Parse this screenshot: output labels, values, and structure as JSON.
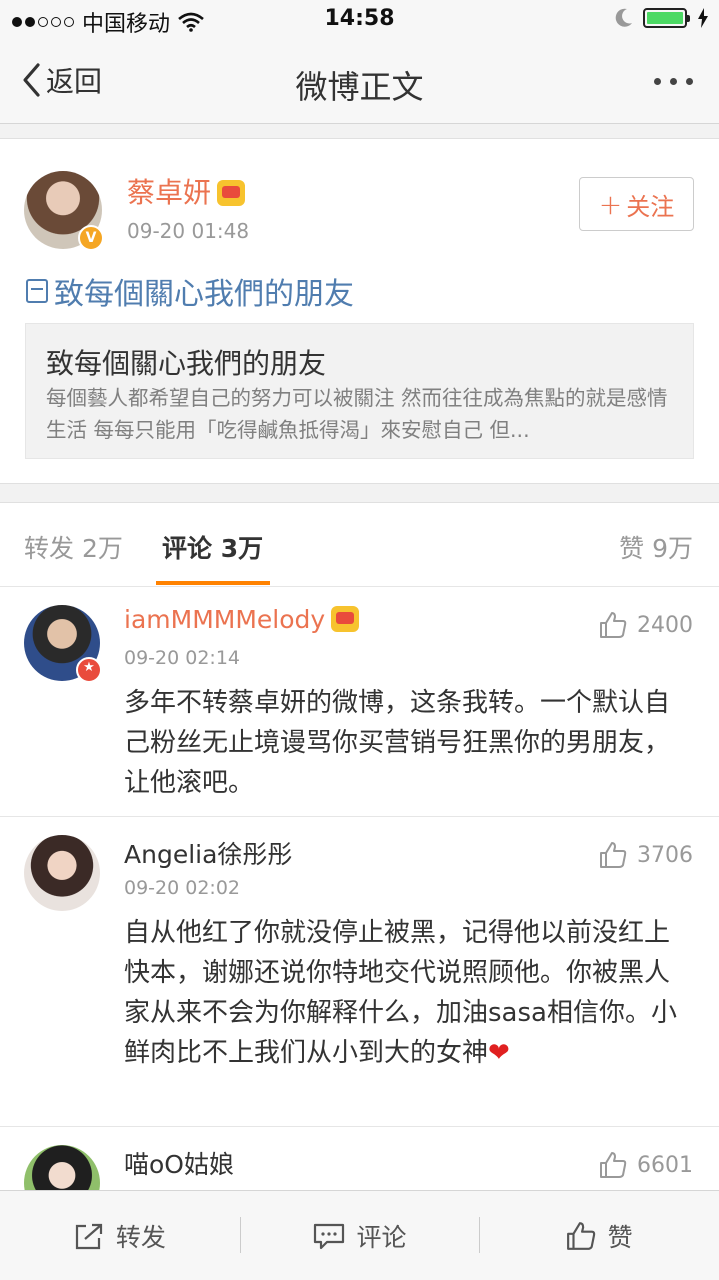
{
  "status_bar": {
    "carrier": "中国移动",
    "time": "14:58"
  },
  "nav": {
    "back_label": "返回",
    "title": "微博正文"
  },
  "post": {
    "author": "蔡卓妍",
    "time": "09-20 01:48",
    "follow_label": "关注",
    "text": "致每個關心我們的朋友",
    "article": {
      "title": "致每個關心我們的朋友",
      "summary": "每個藝人都希望自己的努力可以被關注 然而往往成為焦點的就是感情生活 每每只能用「吃得鹹魚抵得渴」來安慰自己 但..."
    }
  },
  "tabs": {
    "repost": "转发 2万",
    "comment": "评论 3万",
    "like": "赞 9万"
  },
  "comments": [
    {
      "name": "iamMMMMelody",
      "time": "09-20 02:14",
      "likes": "2400",
      "text": "多年不转蔡卓妍的微博，这条我转。一个默认自己粉丝无止境谩骂你买营销号狂黑你的男朋友，让他滚吧。"
    },
    {
      "name": "Angelia徐彤彤",
      "time": "09-20 02:02",
      "likes": "3706",
      "text": "自从他红了你就没停止被黑，记得他以前没红上快本，谢娜还说你特地交代说照顾他。你被黑人家从来不会为你解释什么，加油sasa相信你。小鲜肉比不上我们从小到大的女神"
    },
    {
      "name": "喵oO姑娘",
      "likes": "6601"
    }
  ],
  "toolbar": {
    "repost": "转发",
    "comment": "评论",
    "like": "赞"
  }
}
